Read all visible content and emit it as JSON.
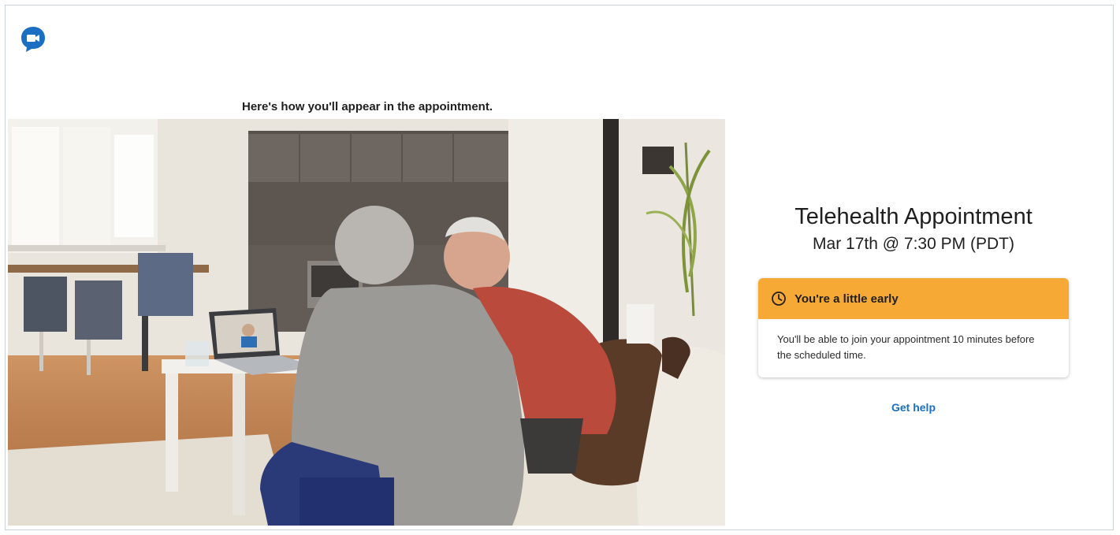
{
  "brand": {
    "logo_icon": "video-chat-bubble-icon",
    "logo_color": "#1a6fc2"
  },
  "preview": {
    "caption": "Here's how you'll appear in the appointment.",
    "image_description_icon": "camera-preview-image"
  },
  "appointment": {
    "title": "Telehealth Appointment",
    "datetime": "Mar 17th @ 7:30 PM (PDT)"
  },
  "notice": {
    "icon": "clock-icon",
    "heading": "You're a little early",
    "body": "You'll be able to join your appointment 10 minutes before the scheduled time.",
    "accent_color": "#f7a935"
  },
  "help": {
    "label": "Get help",
    "color": "#1a6fc2"
  }
}
